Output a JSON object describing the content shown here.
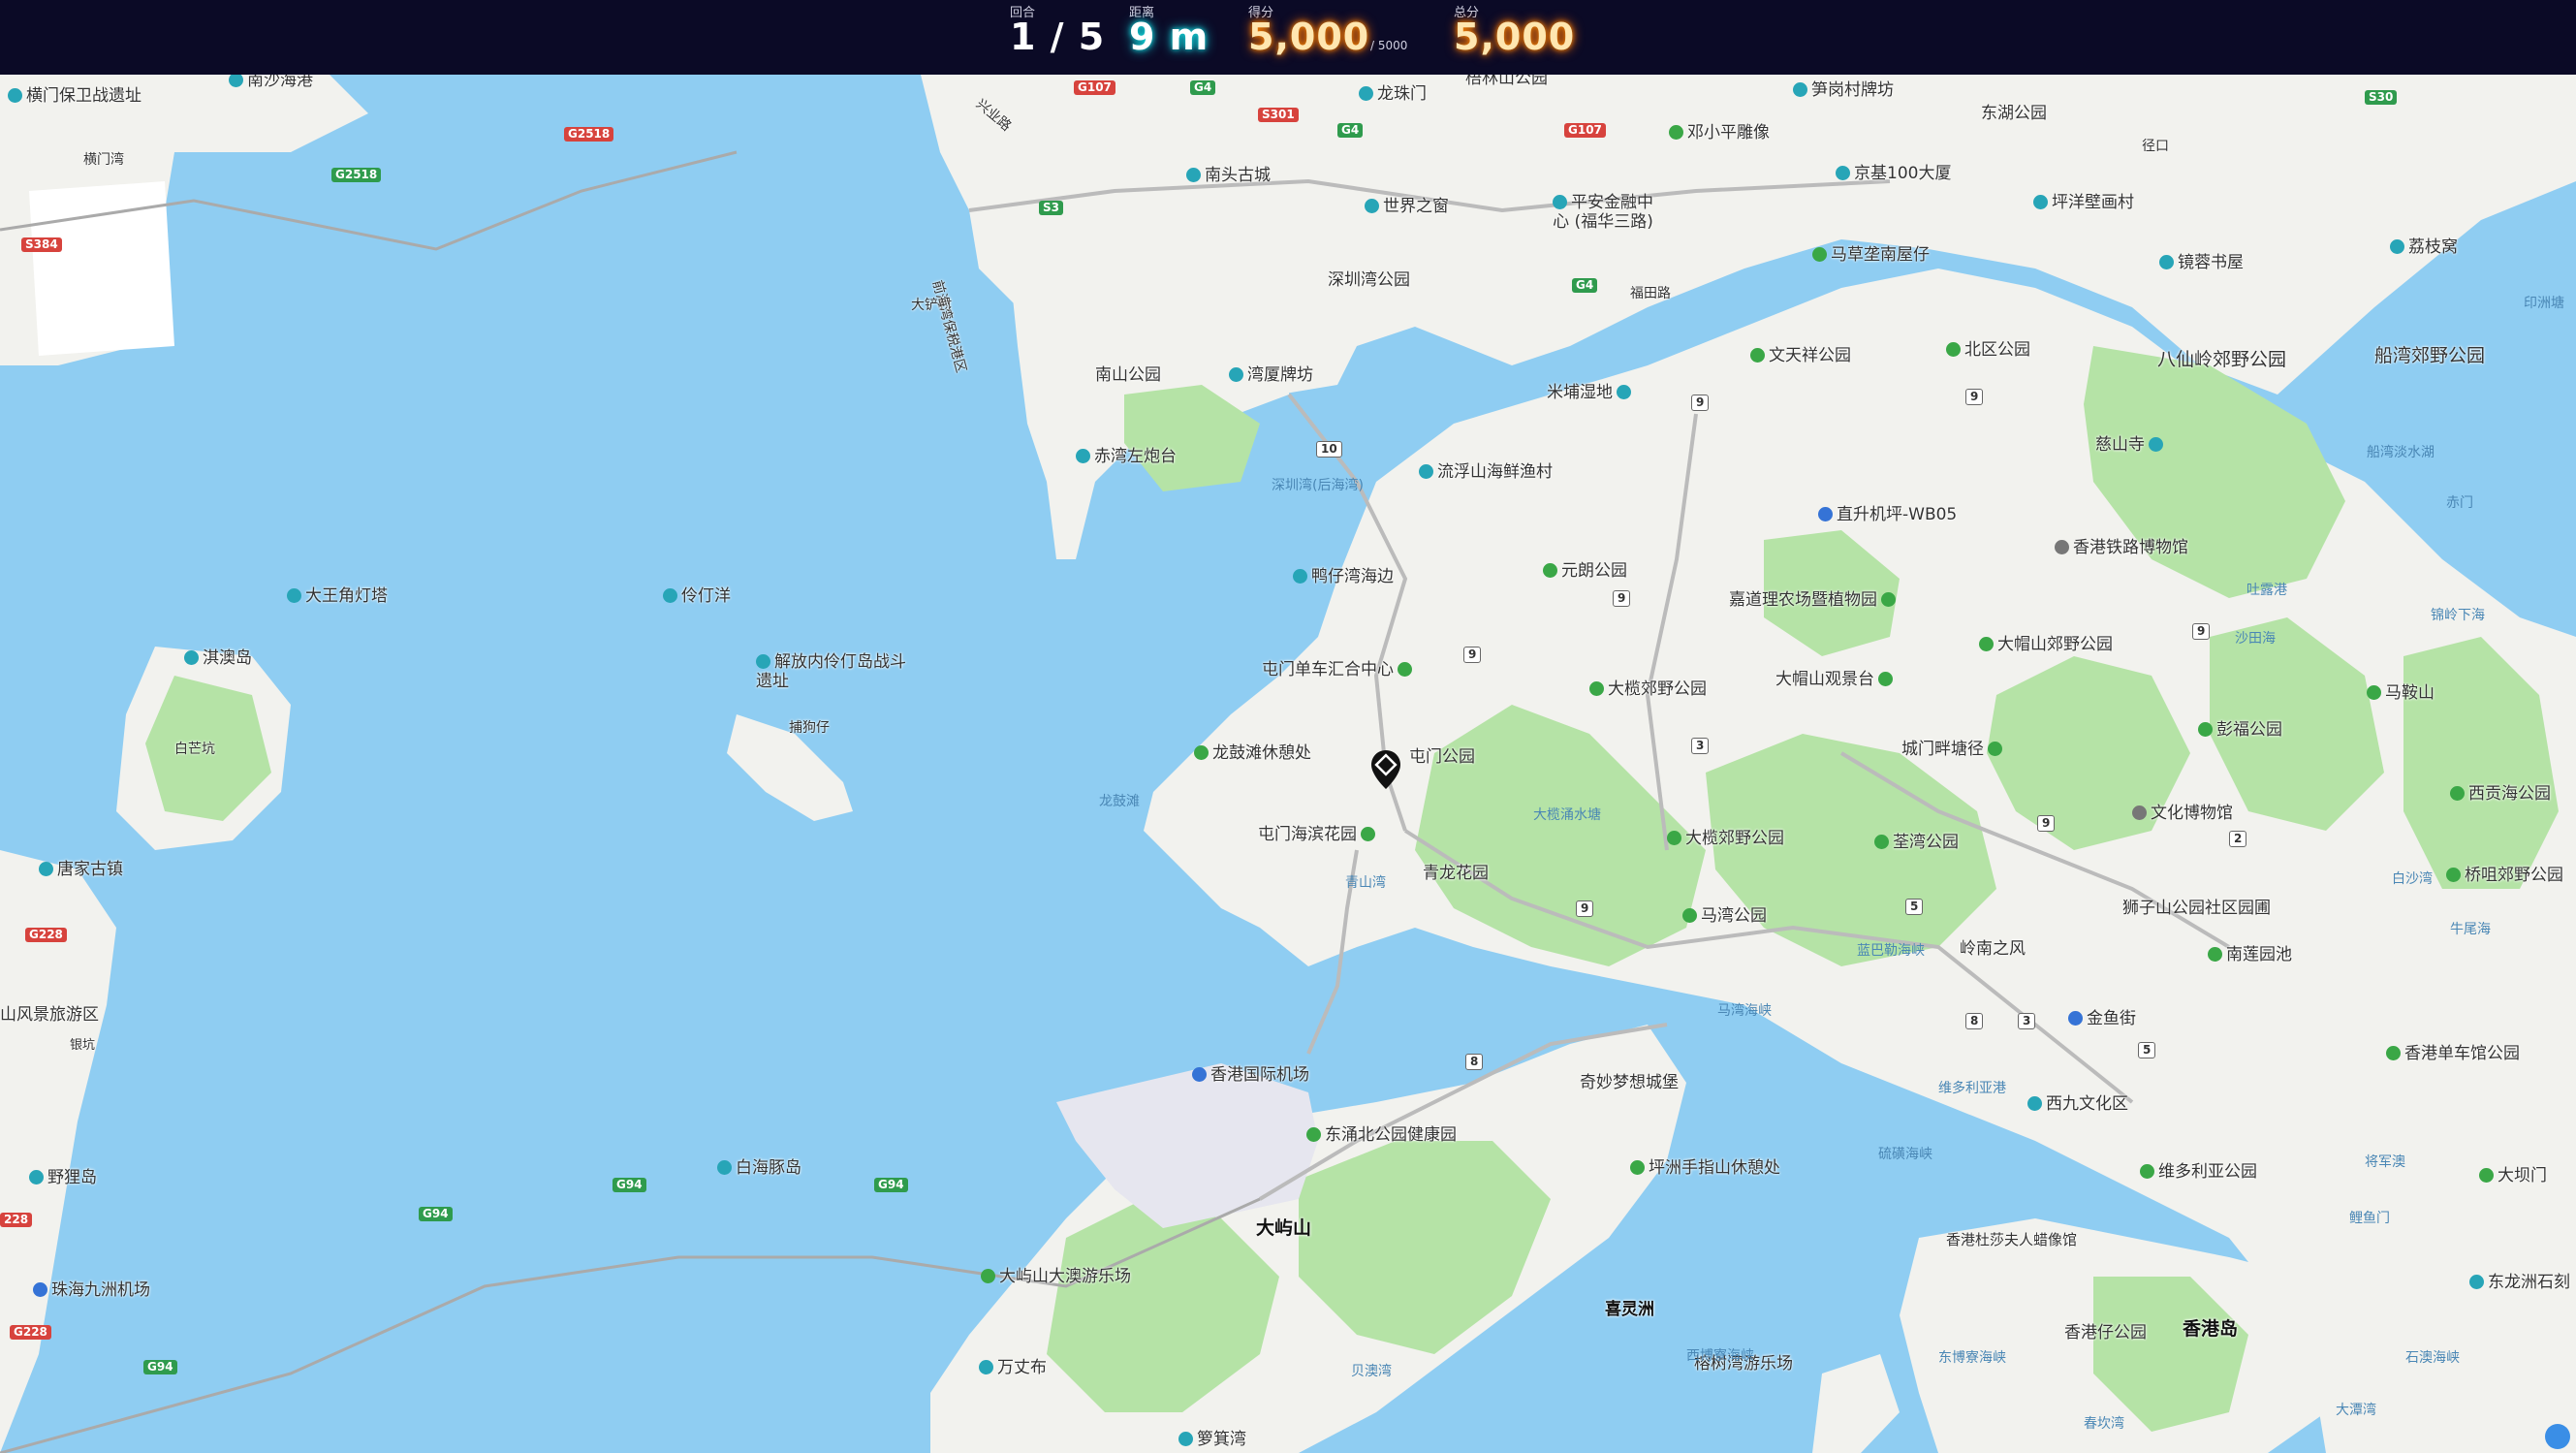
{
  "hud": {
    "round": {
      "label": "回合",
      "value": "1 / 5"
    },
    "distance": {
      "label": "距离",
      "value": "9 m"
    },
    "score": {
      "label": "得分",
      "value": "5,000",
      "suffix": "/ 5000"
    },
    "total": {
      "label": "总分",
      "value": "5,000"
    }
  },
  "map": {
    "labels": [
      {
        "text": "横门保卫战遗址",
        "icon": "teal"
      },
      {
        "text": "南沙海港",
        "icon": "teal"
      },
      {
        "text": "横门湾",
        "icon": ""
      },
      {
        "text": "大铲村",
        "icon": ""
      },
      {
        "text": "龙珠门",
        "icon": "teal"
      },
      {
        "text": "南头古城",
        "icon": "teal"
      },
      {
        "text": "世界之窗",
        "icon": "teal"
      },
      {
        "text": "平安金融中心 (福华三路)",
        "icon": "teal"
      },
      {
        "text": "邓小平雕像",
        "icon": "green"
      },
      {
        "text": "笋岗村牌坊",
        "icon": "teal"
      },
      {
        "text": "东湖公园",
        "icon": ""
      },
      {
        "text": "京基100大厦",
        "icon": "teal"
      },
      {
        "text": "梧林山公园",
        "icon": ""
      },
      {
        "text": "坪洋壁画村",
        "icon": "teal"
      },
      {
        "text": "马草垄南屋仔",
        "icon": "green"
      },
      {
        "text": "镜蓉书屋",
        "icon": "teal"
      },
      {
        "text": "荔枝窝",
        "icon": "teal"
      },
      {
        "text": "深圳湾公园",
        "icon": ""
      },
      {
        "text": "南山公园",
        "icon": ""
      },
      {
        "text": "湾厦牌坊",
        "icon": "teal"
      },
      {
        "text": "米埔湿地",
        "icon": "teal"
      },
      {
        "text": "文天祥公园",
        "icon": "green"
      },
      {
        "text": "北区公园",
        "icon": "green"
      },
      {
        "text": "八仙岭郊野公园",
        "icon": ""
      },
      {
        "text": "船湾郊野公园",
        "icon": ""
      },
      {
        "text": "赤湾左炮台",
        "icon": "teal"
      },
      {
        "text": "流浮山海鲜渔村",
        "icon": "teal"
      },
      {
        "text": "深圳湾(后海湾)",
        "icon": "water"
      },
      {
        "text": "直升机坪-WB05",
        "icon": "blue"
      },
      {
        "text": "慈山寺",
        "icon": "teal"
      },
      {
        "text": "香港铁路博物馆",
        "icon": "gray"
      },
      {
        "text": "鸭仔湾海边",
        "icon": "teal"
      },
      {
        "text": "元朗公园",
        "icon": "green"
      },
      {
        "text": "嘉道理农场暨植物园",
        "icon": "green"
      },
      {
        "text": "大王角灯塔",
        "icon": "teal"
      },
      {
        "text": "伶仃洋",
        "icon": "teal"
      },
      {
        "text": "淇澳岛",
        "icon": "teal"
      },
      {
        "text": "解放内伶仃岛战斗遗址",
        "icon": "teal"
      },
      {
        "text": "屯门单车汇合中心",
        "icon": "green"
      },
      {
        "text": "大榄郊野公园",
        "icon": "green"
      },
      {
        "text": "大帽山观景台",
        "icon": "green"
      },
      {
        "text": "大帽山郊野公园",
        "icon": "green"
      },
      {
        "text": "马鞍山",
        "icon": "green"
      },
      {
        "text": "白芒坑",
        "icon": ""
      },
      {
        "text": "龙鼓滩休憩处",
        "icon": "green"
      },
      {
        "text": "屯门公园",
        "icon": "green"
      },
      {
        "text": "城门畔塘径",
        "icon": "green"
      },
      {
        "text": "彭福公园",
        "icon": "green"
      },
      {
        "text": "文化博物馆",
        "icon": "gray"
      },
      {
        "text": "西贡海公园",
        "icon": "green"
      },
      {
        "text": "龙鼓滩",
        "icon": "water"
      },
      {
        "text": "屯门海滨花园",
        "icon": "green"
      },
      {
        "text": "青龙花园",
        "icon": "green"
      },
      {
        "text": "荃湾公园",
        "icon": "green"
      },
      {
        "text": "大榄郊野公园",
        "icon": "green"
      },
      {
        "text": "唐家古镇",
        "icon": "teal"
      },
      {
        "text": "马湾公园",
        "icon": "green"
      },
      {
        "text": "狮子山公园社区园圃",
        "icon": "green"
      },
      {
        "text": "岭南之风",
        "icon": "green"
      },
      {
        "text": "南莲园池",
        "icon": "green"
      },
      {
        "text": "桥咀郊野公园",
        "icon": "green"
      },
      {
        "text": "山风景旅游区",
        "icon": ""
      },
      {
        "text": "金鱼街",
        "icon": "blue"
      },
      {
        "text": "香港国际机场",
        "icon": "blue"
      },
      {
        "text": "奇妙梦想城堡",
        "icon": ""
      },
      {
        "text": "香港单车馆公园",
        "icon": "green"
      },
      {
        "text": "东涌北公园健康园",
        "icon": "green"
      },
      {
        "text": "西九文化区",
        "icon": "teal"
      },
      {
        "text": "野狸岛",
        "icon": "teal"
      },
      {
        "text": "白海豚岛",
        "icon": "teal"
      },
      {
        "text": "坪洲手指山休憩处",
        "icon": "green"
      },
      {
        "text": "维多利亚公园",
        "icon": "green"
      },
      {
        "text": "大屿山",
        "icon": "big"
      },
      {
        "text": "香港杜莎夫人蜡像馆",
        "icon": ""
      },
      {
        "text": "珠海九洲机场",
        "icon": "blue"
      },
      {
        "text": "大屿山大澳游乐场",
        "icon": "green"
      },
      {
        "text": "喜灵洲",
        "icon": "big"
      },
      {
        "text": "香港岛",
        "icon": "big"
      },
      {
        "text": "万丈布",
        "icon": "teal"
      },
      {
        "text": "榕树湾游乐场",
        "icon": "green"
      },
      {
        "text": "箩箕湾",
        "icon": "teal"
      },
      {
        "text": "大坝门",
        "icon": "green"
      },
      {
        "text": "东龙洲石刻",
        "icon": "teal"
      },
      {
        "text": "捕狗仔",
        "icon": ""
      },
      {
        "text": "青山湾",
        "icon": "water"
      },
      {
        "text": "马湾海峡",
        "icon": "water"
      },
      {
        "text": "维多利亚港",
        "icon": "water"
      },
      {
        "text": "蓝巴勒海峡",
        "icon": "water"
      },
      {
        "text": "硫磺海峡",
        "icon": "water"
      },
      {
        "text": "西博寮海峡",
        "icon": "water"
      },
      {
        "text": "东博寮海峡",
        "icon": "water"
      },
      {
        "text": "贝澳湾",
        "icon": "water"
      },
      {
        "text": "印洲塘",
        "icon": "water"
      },
      {
        "text": "船湾淡水湖",
        "icon": "water"
      },
      {
        "text": "吐露港",
        "icon": "water"
      },
      {
        "text": "沙田海",
        "icon": "water"
      },
      {
        "text": "白沙湾",
        "icon": "water"
      },
      {
        "text": "牛尾海",
        "icon": "water"
      },
      {
        "text": "将军澳",
        "icon": "water"
      },
      {
        "text": "赤门",
        "icon": "water"
      },
      {
        "text": "鲤鱼门",
        "icon": "water"
      },
      {
        "text": "大潭湾",
        "icon": "water"
      },
      {
        "text": "石澳海峡",
        "icon": "water"
      },
      {
        "text": "香港仔公园",
        "icon": "green"
      },
      {
        "text": "春坎湾",
        "icon": "water"
      },
      {
        "text": "银坑",
        "icon": ""
      },
      {
        "text": "大榄涌水塘",
        "icon": "water"
      },
      {
        "text": "福田路",
        "icon": ""
      },
      {
        "text": "兴业路",
        "icon": ""
      },
      {
        "text": "前海湾保税港区",
        "icon": ""
      },
      {
        "text": "径口",
        "icon": ""
      },
      {
        "text": "锦岭下海",
        "icon": "water"
      }
    ],
    "road_shields": [
      {
        "text": "G107",
        "color": "red"
      },
      {
        "text": "G4",
        "color": "green"
      },
      {
        "text": "S301",
        "color": "red"
      },
      {
        "text": "G2518",
        "color": "red"
      },
      {
        "text": "G2518",
        "color": "green"
      },
      {
        "text": "S384",
        "color": "red"
      },
      {
        "text": "S3",
        "color": "green"
      },
      {
        "text": "G4",
        "color": "green"
      },
      {
        "text": "G107",
        "color": "red"
      },
      {
        "text": "G4",
        "color": "green"
      },
      {
        "text": "S30",
        "color": "green"
      },
      {
        "text": "10",
        "color": "white"
      },
      {
        "text": "9",
        "color": "white"
      },
      {
        "text": "9",
        "color": "white"
      },
      {
        "text": "9",
        "color": "white"
      },
      {
        "text": "9",
        "color": "white"
      },
      {
        "text": "3",
        "color": "white"
      },
      {
        "text": "9",
        "color": "white"
      },
      {
        "text": "9",
        "color": "white"
      },
      {
        "text": "2",
        "color": "white"
      },
      {
        "text": "9",
        "color": "white"
      },
      {
        "text": "5",
        "color": "white"
      },
      {
        "text": "8",
        "color": "white"
      },
      {
        "text": "8",
        "color": "white"
      },
      {
        "text": "3",
        "color": "white"
      },
      {
        "text": "5",
        "color": "white"
      },
      {
        "text": "G228",
        "color": "red"
      },
      {
        "text": "G94",
        "color": "green"
      },
      {
        "text": "G94",
        "color": "green"
      },
      {
        "text": "G94",
        "color": "green"
      },
      {
        "text": "G94",
        "color": "green"
      },
      {
        "text": "G228",
        "color": "red"
      },
      {
        "text": "228",
        "color": "red"
      }
    ]
  }
}
